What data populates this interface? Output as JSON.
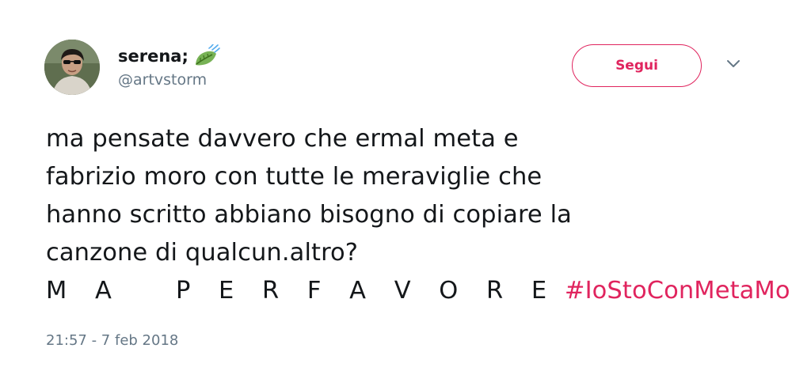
{
  "user": {
    "display_name": "serena;",
    "name_emoji": "leaf-fluttering-in-wind-icon",
    "handle": "@artvstorm",
    "avatar": "avatar"
  },
  "actions": {
    "follow_label": "Segui",
    "menu_icon": "chevron-down-icon"
  },
  "tweet": {
    "lines": [
      "ma pensate davvero che ermal meta e",
      "fabrizio moro con tutte le meraviglie che",
      "hanno scritto abbiano bisogno di copiare la",
      "canzone di qualcun.altro?"
    ],
    "shout": "M A   P E R F A V O R E",
    "hashtag": "#IoStoConMetaMoro"
  },
  "timestamp": "21:57 - 7 feb 2018",
  "colors": {
    "accent": "#e0245e",
    "text": "#14171a",
    "muted": "#657786"
  }
}
